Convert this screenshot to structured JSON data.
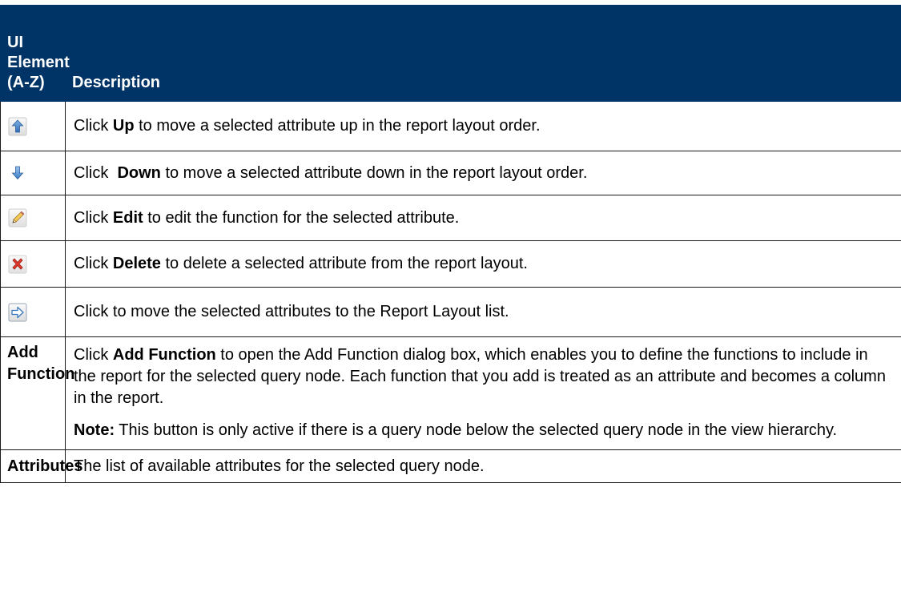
{
  "header": {
    "col1": [
      "UI",
      "Element",
      "(A-Z)"
    ],
    "col2": "Description"
  },
  "rows": [
    {
      "element_icon": "up-arrow-icon",
      "desc": {
        "pre": "Click ",
        "bold": "Up",
        "post": " to move a selected attribute up in the report layout order."
      }
    },
    {
      "element_icon": "down-arrow-icon",
      "desc": {
        "pre": "Click  ",
        "bold": "Down",
        "post": " to move a selected attribute down in the report layout order."
      }
    },
    {
      "element_icon": "pencil-edit-icon",
      "desc": {
        "pre": "Click ",
        "bold": "Edit",
        "post": " to edit the function for the selected attribute."
      }
    },
    {
      "element_icon": "red-x-delete-icon",
      "desc": {
        "pre": "Click ",
        "bold": "Delete",
        "post": " to delete a selected attribute from the report layout."
      }
    },
    {
      "element_icon": "right-arrow-move-icon",
      "desc": {
        "text": "Click to move the selected attributes to the Report Layout list."
      }
    },
    {
      "element": [
        "Add",
        "Function"
      ],
      "desc": {
        "pre": "Click ",
        "bold": "Add Function",
        "post": " to open the Add Function dialog box, which enables you to define the functions to include in the report for the selected query node. Each function that you add is treated as an attribute and becomes a column in the report.",
        "note_bold": "Note:",
        "note": " This button is only active if there is a query node below the selected query node in the view hierarchy."
      }
    },
    {
      "element": "Attributes",
      "desc": {
        "text": "The list of available attributes for the selected query node."
      }
    }
  ],
  "colors": {
    "header_bg": "#003366",
    "header_text": "#ffffff",
    "border": "#1a1a1a"
  }
}
